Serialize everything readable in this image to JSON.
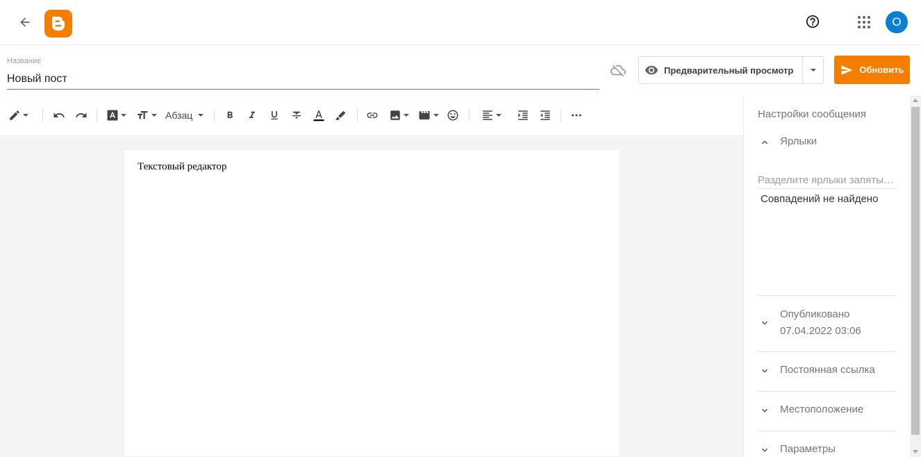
{
  "header": {
    "avatar_letter": "O",
    "brand_color": "#f57d00",
    "avatar_color": "#0b7fd4"
  },
  "post": {
    "title_label": "Название",
    "title_value": "Новый пост",
    "preview_label": "Предварительный просмотр",
    "update_label": "Обновить"
  },
  "toolbar": {
    "paragraph_label": "Абзац",
    "icons": [
      "pencil-icon",
      "undo-icon",
      "redo-icon",
      "font-icon",
      "font-size-icon",
      "bold-icon",
      "italic-icon",
      "underline-icon",
      "strikethrough-icon",
      "text-color-icon",
      "highlight-icon",
      "link-icon",
      "image-icon",
      "video-icon",
      "emoji-icon",
      "align-icon",
      "indent-icon",
      "outdent-icon",
      "more-icon"
    ]
  },
  "editor": {
    "content": "Текстовый редактор"
  },
  "sidebar": {
    "title": "Настройки сообщения",
    "labels": {
      "heading": "Ярлыки",
      "placeholder": "Разделите ярлыки запятыми",
      "no_match": "Совпадений не найдено"
    },
    "published": {
      "heading": "Опубликовано",
      "datetime": "07.04.2022 03:06"
    },
    "permalink": "Постоянная ссылка",
    "location": "Местоположение",
    "options": "Параметры"
  }
}
